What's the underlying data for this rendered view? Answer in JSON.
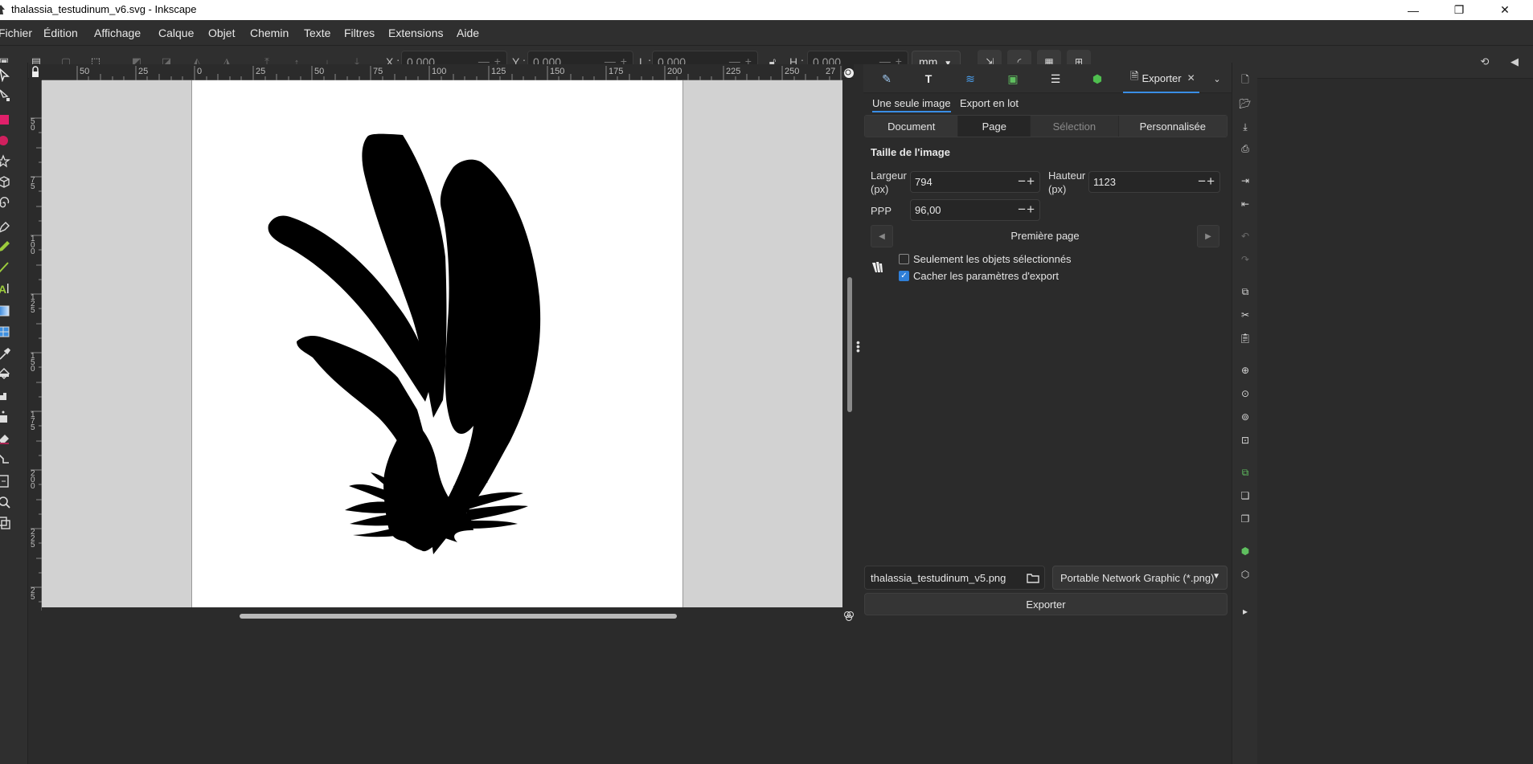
{
  "window": {
    "title": "thalassia_testudinum_v6.svg - Inkscape",
    "controls": [
      "minimize",
      "restore",
      "close"
    ]
  },
  "menu": [
    "Fichier",
    "Édition",
    "Affichage",
    "Calque",
    "Objet",
    "Chemin",
    "Texte",
    "Filtres",
    "Extensions",
    "Aide"
  ],
  "toolbar": {
    "x_label": "X :",
    "x_value": "0,000",
    "y_label": "Y :",
    "y_value": "0,000",
    "w_label": "L :",
    "w_value": "0,000",
    "h_label": "H :",
    "h_value": "0,000",
    "unit": "mm"
  },
  "rulers": {
    "horizontal": [
      "50",
      "25",
      "0",
      "25",
      "50",
      "75",
      "100",
      "125",
      "150",
      "175",
      "200",
      "225",
      "250",
      "27"
    ],
    "vertical": [
      "5\n0",
      "7\n5",
      "1\n0\n0",
      "1\n2\n5",
      "1\n5\n0",
      "1\n7\n5",
      "2\n0\n0",
      "2\n2\n5",
      "2\n5"
    ]
  },
  "dock": {
    "active_tab": "Exporter",
    "subtabs": {
      "single": "Une seule image",
      "batch": "Export en lot"
    },
    "area_options": [
      "Document",
      "Page",
      "Sélection",
      "Personnalisée"
    ],
    "area_active": "Page",
    "area_disabled": "Sélection",
    "image_size_title": "Taille de l'image",
    "width_label": "Largeur\n(px)",
    "width_value": "794",
    "height_label": "Hauteur\n(px)",
    "height_value": "1123",
    "dpi_label": "PPP",
    "dpi_value": "96,00",
    "page_nav_label": "Première page",
    "only_selected_label": "Seulement les objets sélectionnés",
    "only_selected_checked": false,
    "hide_export_label": "Cacher les paramètres d'export",
    "hide_export_checked": true,
    "filename": "thalassia_testudinum_v5.png",
    "format": "Portable Network Graphic (*.png)",
    "export_button": "Exporter"
  },
  "colors": {
    "accent": "#3a8ee6",
    "checkbox_checked": "#2f7fd8",
    "panel_bg": "#2b2b2b",
    "canvas_bg": "#d2d2d2",
    "page_bg": "#ffffff",
    "drawing_fill": "#000000"
  }
}
